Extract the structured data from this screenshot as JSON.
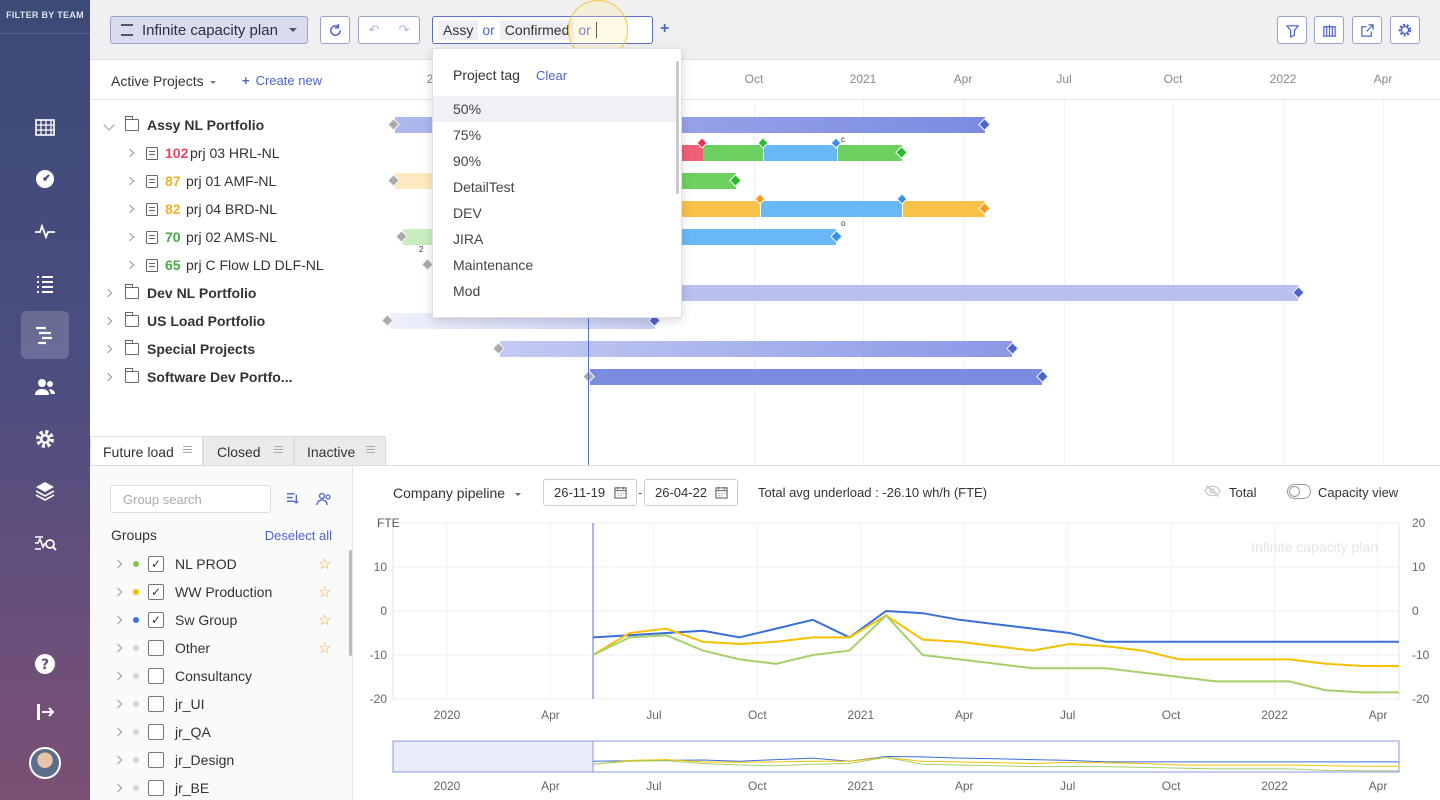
{
  "rail": {
    "title": "FILTER BY TEAM",
    "icons": [
      "calendar-grid-icon",
      "dashboard-gauge-icon",
      "pulse-icon",
      "list-icon",
      "gantt-icon",
      "users-icon",
      "settings-gear-icon",
      "layers-icon",
      "analytics-search-icon",
      "help-icon",
      "logout-icon"
    ],
    "active_icon": "gantt-icon"
  },
  "toolbar": {
    "plan_name": "Infinite capacity plan",
    "filter_chips": [
      "Assy",
      "Confirmed"
    ],
    "or_label": "or",
    "right_icons": [
      "filter-heart-icon",
      "columns-icon",
      "export-icon",
      "settings-icon"
    ]
  },
  "gantt": {
    "header_title": "Active Projects",
    "create_new": "Create new",
    "months": [
      "2",
      "Oct",
      "2021",
      "Apr",
      "Jul",
      "Oct",
      "2022",
      "Apr"
    ],
    "rows": [
      {
        "name": "Assy NL Portfolio",
        "type": "portfolio",
        "expanded": true
      },
      {
        "score": "102",
        "score_color": "#e8485b",
        "name": "prj 03 HRL-NL",
        "type": "project"
      },
      {
        "score": "87",
        "score_color": "#f0b323",
        "name": "prj 01 AMF-NL",
        "type": "project"
      },
      {
        "score": "82",
        "score_color": "#f0b323",
        "name": "prj 04 BRD-NL",
        "type": "project"
      },
      {
        "score": "70",
        "score_color": "#48a846",
        "name": "prj 02 AMS-NL",
        "type": "project"
      },
      {
        "score": "65",
        "score_color": "#48a846",
        "name": "prj C Flow LD DLF-NL",
        "type": "project"
      },
      {
        "name": "Dev NL Portfolio",
        "type": "portfolio"
      },
      {
        "name": "US Load Portfolio",
        "type": "portfolio"
      },
      {
        "name": "Special Projects",
        "type": "portfolio"
      },
      {
        "name": "Software Dev Portfo...",
        "type": "portfolio"
      }
    ],
    "milestone_labels": [
      "c",
      "o",
      "2"
    ]
  },
  "dropdown": {
    "title": "Project tag",
    "clear": "Clear",
    "items": [
      "50%",
      "75%",
      "90%",
      "DetailTest",
      "DEV",
      "JIRA",
      "Maintenance",
      "Mod"
    ]
  },
  "tabs": [
    "Future load",
    "Closed",
    "Inactive"
  ],
  "groups": {
    "search_placeholder": "Group search",
    "title": "Groups",
    "deselect": "Deselect all",
    "items": [
      {
        "label": "NL PROD",
        "checked": true,
        "dot": "#8bc34a",
        "star": true
      },
      {
        "label": "WW Production",
        "checked": true,
        "dot": "#f5c000",
        "star": true
      },
      {
        "label": "Sw Group",
        "checked": true,
        "dot": "#3b6fd8",
        "star": true
      },
      {
        "label": "Other",
        "checked": false,
        "dot": "#ccc",
        "star": true
      },
      {
        "label": "Consultancy",
        "checked": false,
        "dot": "#ccc",
        "star": false
      },
      {
        "label": "jr_UI",
        "checked": false,
        "dot": "#ccc",
        "star": false
      },
      {
        "label": "jr_QA",
        "checked": false,
        "dot": "#ccc",
        "star": false
      },
      {
        "label": "jr_Design",
        "checked": false,
        "dot": "#ccc",
        "star": false
      },
      {
        "label": "jr_BE",
        "checked": false,
        "dot": "#ccc",
        "star": false
      }
    ]
  },
  "load_chart": {
    "pipeline_select": "Company pipeline",
    "date_from": "26-11-19",
    "date_sep": "-",
    "date_to": "26-04-22",
    "total_avg": "Total avg underload : -26.10 wh/h (FTE)",
    "total_label": "Total",
    "capacity_view": "Capacity view",
    "watermark": "Infinite capacity plan"
  },
  "chart_data": {
    "type": "line",
    "ylabel": "FTE",
    "ylim": [
      -20,
      20
    ],
    "yticks_left": [
      10,
      0,
      -10,
      -20
    ],
    "yticks_right": [
      20,
      10,
      0,
      -10,
      -20
    ],
    "x_labels": [
      "2020",
      "Apr",
      "Jul",
      "Oct",
      "2021",
      "Apr",
      "Jul",
      "Oct",
      "2022",
      "Apr"
    ],
    "x": [
      "2020-06",
      "2020-07",
      "2020-08",
      "2020-09",
      "2020-10",
      "2020-11",
      "2020-12",
      "2021-01",
      "2021-02",
      "2021-03",
      "2021-04",
      "2021-05",
      "2021-06",
      "2021-07",
      "2021-08",
      "2021-09",
      "2021-10",
      "2021-11",
      "2021-12",
      "2022-01",
      "2022-02",
      "2022-03",
      "2022-04"
    ],
    "series": [
      {
        "color": "#3b6fd8",
        "values": [
          -6,
          -5.5,
          -5,
          -4.5,
          -6,
          -4,
          -2,
          -6,
          0,
          -0.5,
          -2,
          -3,
          -4,
          -5,
          -7,
          -7,
          -7,
          -7,
          -7,
          -7,
          -7,
          -7,
          -7
        ]
      },
      {
        "color": "#f5c000",
        "values": [
          -10,
          -5,
          -4,
          -7,
          -7.5,
          -7,
          -6,
          -6,
          -1,
          -6.5,
          -7,
          -8,
          -9,
          -7.5,
          -8,
          -9,
          -11,
          -11,
          -11,
          -11,
          -12,
          -12.5,
          -12.5
        ]
      },
      {
        "color": "#a5d06a",
        "values": [
          -10,
          -6,
          -5.5,
          -9,
          -11,
          -12,
          -10,
          -9,
          -1,
          -10,
          -11,
          -12,
          -13,
          -13,
          -13,
          -14,
          -15,
          -16,
          -16,
          -16,
          -18,
          -18.5,
          -18.5
        ]
      }
    ],
    "grid": true,
    "legend": "none"
  }
}
